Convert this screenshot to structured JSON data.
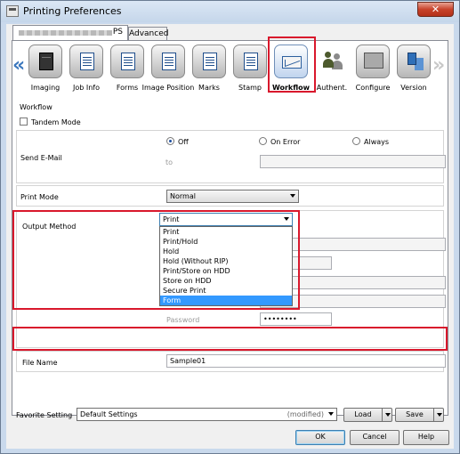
{
  "window": {
    "title": "Printing Preferences",
    "close_glyph": "✕"
  },
  "tabs": {
    "ps_label": "PS",
    "advanced_label": "Advanced"
  },
  "iconbar": {
    "items": [
      {
        "label": "Imaging",
        "icon": "imaging-icon"
      },
      {
        "label": "Job Info",
        "icon": "job-info-icon"
      },
      {
        "label": "Forms",
        "icon": "forms-icon"
      },
      {
        "label": "Image Position",
        "icon": "image-position-icon"
      },
      {
        "label": "Marks",
        "icon": "marks-icon"
      },
      {
        "label": "Stamp",
        "icon": "stamp-icon"
      },
      {
        "label": "Workflow",
        "icon": "workflow-icon"
      },
      {
        "label": "Authent.",
        "icon": "authentication-icon"
      },
      {
        "label": "Configure",
        "icon": "configure-icon"
      },
      {
        "label": "Version",
        "icon": "version-icon"
      }
    ],
    "left_arrow": "«",
    "right_arrow": "»"
  },
  "workflow": {
    "section_title": "Workflow",
    "tandem_mode_label": "Tandem Mode",
    "send_email": {
      "label": "Send E-Mail",
      "options": [
        "Off",
        "On Error",
        "Always"
      ],
      "selected": "Off",
      "to_label": "to"
    },
    "print_mode": {
      "label": "Print Mode",
      "value": "Normal"
    },
    "output_method": {
      "label": "Output Method",
      "value": "Print",
      "options": [
        "Print",
        "Print/Hold",
        "Hold",
        "Hold (Without RIP)",
        "Print/Store on HDD",
        "Store on HDD",
        "Secure Print",
        "Form"
      ],
      "highlighted": "Form"
    },
    "password": {
      "label": "Password",
      "value": "••••••••"
    },
    "file_name": {
      "label": "File Name",
      "value": "Sample01"
    }
  },
  "favorite": {
    "label": "Favorite Setting",
    "value": "Default Settings",
    "status": "(modified)",
    "load_label": "Load",
    "save_label": "Save"
  },
  "footer": {
    "ok_label": "OK",
    "cancel_label": "Cancel",
    "help_label": "Help"
  },
  "colors": {
    "highlight": "#d9182c",
    "selection": "#3399ff"
  }
}
